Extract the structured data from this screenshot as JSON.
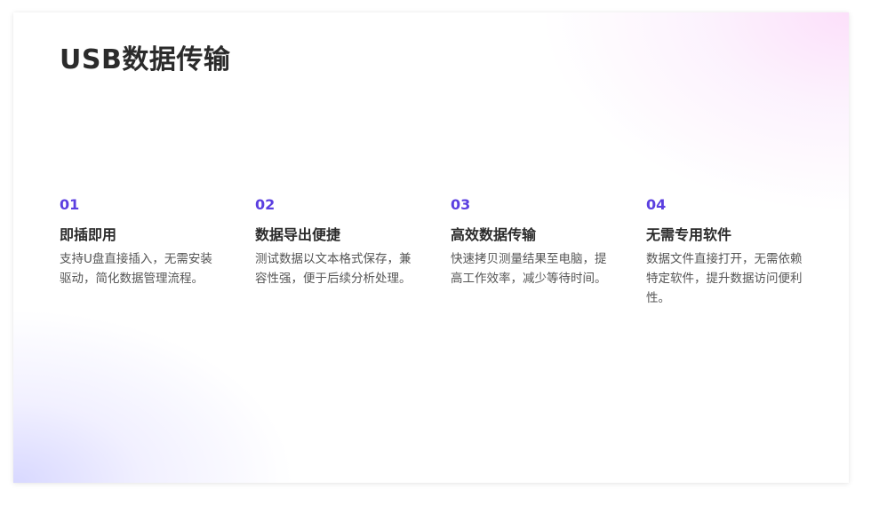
{
  "title": "USB数据传输",
  "colors": {
    "accent": "#5b3fe0",
    "heading": "#2b2b2b",
    "body_text": "#555555"
  },
  "features": [
    {
      "number": "01",
      "heading": "即插即用",
      "description": "支持U盘直接插入，无需安装驱动，简化数据管理流程。"
    },
    {
      "number": "02",
      "heading": "数据导出便捷",
      "description": "测试数据以文本格式保存，兼容性强，便于后续分析处理。"
    },
    {
      "number": "03",
      "heading": "高效数据传输",
      "description": "快速拷贝测量结果至电脑，提高工作效率，减少等待时间。"
    },
    {
      "number": "04",
      "heading": "无需专用软件",
      "description": "数据文件直接打开，无需依赖特定软件，提升数据访问便利性。"
    }
  ]
}
